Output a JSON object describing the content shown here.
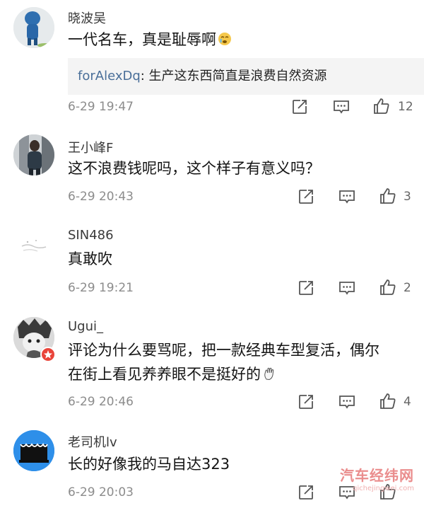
{
  "comments": [
    {
      "username": "晓波吴",
      "text": "一代名车，真是耻辱啊",
      "emoji": "crying-face-emoji",
      "reply": {
        "user": "forAlexDq",
        "text": ": 生产这东西简直是浪费自然资源"
      },
      "time": "6-29 19:47",
      "likes": "12"
    },
    {
      "username": "王小峰F",
      "text": "这不浪费钱呢吗，这个样子有意义吗？",
      "time": "6-29 20:43",
      "likes": "3"
    },
    {
      "username": "SIN486",
      "text": "真敢吹",
      "time": "6-29 19:21",
      "likes": "2"
    },
    {
      "username": "Ugui_",
      "text_lines": [
        "评论为什么要骂呢，把一款经典车型复活，偶尔",
        "在街上看见养养眼不是挺好的"
      ],
      "emoji": "hand-gesture-emoji",
      "time": "6-29 20:46",
      "likes": "4"
    },
    {
      "username": "老司机lv",
      "text": "长的好像我的马自达323",
      "time": "6-29 20:03",
      "likes": ""
    }
  ],
  "watermark": {
    "title": "汽车经纬网",
    "url": "qichejingwei.com"
  },
  "colors": {
    "reply_user": "#4a6f99",
    "meta": "#8c8c8c",
    "watermark": "#ea8d8d"
  }
}
